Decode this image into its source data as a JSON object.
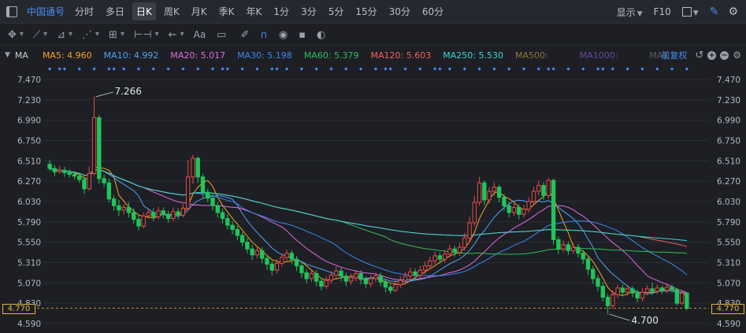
{
  "toolbar": {
    "stock_name": "中国通号",
    "periods": [
      "分时",
      "多日",
      "日K",
      "周K",
      "月K",
      "季K",
      "年K",
      "1分",
      "3分",
      "5分",
      "15分",
      "30分",
      "60分"
    ],
    "active_period": "日K",
    "display_label": "显示",
    "f10_label": "F10"
  },
  "drawing_tools": [
    "crosshair-icon",
    "line-icon",
    "ray-icon",
    "wave-icon",
    "grid-icon",
    "range-icon",
    "arrow-left-icon",
    "text-icon",
    "comment-icon",
    "eraser-icon",
    "magnet-icon",
    "eye-icon",
    "trash-icon",
    "toggle-icon"
  ],
  "ma_bar": {
    "label": "MA",
    "items": [
      {
        "label": "MA5: 4.960",
        "color": "#f5a623"
      },
      {
        "label": "MA10: 4.992",
        "color": "#4fa3f7"
      },
      {
        "label": "MA20: 5.017",
        "color": "#e06ce0"
      },
      {
        "label": "MA30: 5.198",
        "color": "#3f86f0"
      },
      {
        "label": "MA60: 5.379",
        "color": "#2fbf5a"
      },
      {
        "label": "MA120: 5.603",
        "color": "#f06262"
      },
      {
        "label": "MA250: 5.530",
        "color": "#38d6d6"
      },
      {
        "label": "MA500:",
        "color": "#8a7a3a"
      },
      {
        "label": "MA1000:",
        "color": "#6a4a9a"
      },
      {
        "label": "MA1",
        "color": "#5a5f66"
      }
    ],
    "adjust_label": "前复权"
  },
  "price_axis": {
    "ticks": [
      "7.470",
      "7.230",
      "6.990",
      "6.750",
      "6.510",
      "6.270",
      "6.030",
      "5.790",
      "5.550",
      "5.310",
      "5.070",
      "4.830",
      "4.590"
    ],
    "current_price": "4.770"
  },
  "colors": {
    "up": "#e84a4a",
    "down": "#22c45a",
    "accent": "#4a8df0",
    "current": "#e3b53e"
  },
  "chart_data": {
    "type": "candlestick",
    "ylim": [
      4.59,
      7.47
    ],
    "high_label": "7.266",
    "low_label": "4.700",
    "candles": [
      [
        6.47,
        6.42,
        6.52,
        6.39
      ],
      [
        6.42,
        6.38,
        6.46,
        6.33
      ],
      [
        6.38,
        6.4,
        6.45,
        6.36
      ],
      [
        6.4,
        6.37,
        6.44,
        6.32
      ],
      [
        6.37,
        6.35,
        6.41,
        6.31
      ],
      [
        6.35,
        6.33,
        6.39,
        6.29
      ],
      [
        6.33,
        6.29,
        6.37,
        6.25
      ],
      [
        6.29,
        6.18,
        6.34,
        6.12
      ],
      [
        6.18,
        6.36,
        6.44,
        6.16
      ],
      [
        6.36,
        7.02,
        7.266,
        6.34
      ],
      [
        7.02,
        6.3,
        7.05,
        6.24
      ],
      [
        6.3,
        6.25,
        6.35,
        6.2
      ],
      [
        6.25,
        6.06,
        6.3,
        6.02
      ],
      [
        6.06,
        5.98,
        6.1,
        5.92
      ],
      [
        5.98,
        5.93,
        6.05,
        5.86
      ],
      [
        5.93,
        5.96,
        6.0,
        5.88
      ],
      [
        5.96,
        5.9,
        6.02,
        5.84
      ],
      [
        5.9,
        5.82,
        5.95,
        5.77
      ],
      [
        5.82,
        5.74,
        5.87,
        5.69
      ],
      [
        5.74,
        5.86,
        5.9,
        5.71
      ],
      [
        5.86,
        5.9,
        5.94,
        5.83
      ],
      [
        5.9,
        5.85,
        5.95,
        5.8
      ],
      [
        5.85,
        5.92,
        5.97,
        5.82
      ],
      [
        5.92,
        5.88,
        5.96,
        5.83
      ],
      [
        5.88,
        5.83,
        5.92,
        5.78
      ],
      [
        5.83,
        5.91,
        5.96,
        5.8
      ],
      [
        5.91,
        5.87,
        5.95,
        5.82
      ],
      [
        5.87,
        5.95,
        6.0,
        5.84
      ],
      [
        5.95,
        6.32,
        6.52,
        5.92
      ],
      [
        6.32,
        6.54,
        6.58,
        6.24
      ],
      [
        6.54,
        6.32,
        6.56,
        6.25
      ],
      [
        6.32,
        6.14,
        6.36,
        6.08
      ],
      [
        6.14,
        6.07,
        6.18,
        6.02
      ],
      [
        6.07,
        5.98,
        6.12,
        5.92
      ],
      [
        5.98,
        5.9,
        6.02,
        5.84
      ],
      [
        5.9,
        5.83,
        5.95,
        5.77
      ],
      [
        5.83,
        5.75,
        5.88,
        5.7
      ],
      [
        5.75,
        5.7,
        5.8,
        5.64
      ],
      [
        5.7,
        5.63,
        5.74,
        5.57
      ],
      [
        5.63,
        5.55,
        5.67,
        5.5
      ],
      [
        5.55,
        5.47,
        5.6,
        5.42
      ],
      [
        5.47,
        5.4,
        5.52,
        5.34
      ],
      [
        5.4,
        5.45,
        5.5,
        5.36
      ],
      [
        5.45,
        5.36,
        5.49,
        5.3
      ],
      [
        5.36,
        5.29,
        5.4,
        5.22
      ],
      [
        5.29,
        5.22,
        5.33,
        5.16
      ],
      [
        5.22,
        5.3,
        5.35,
        5.18
      ],
      [
        5.3,
        5.37,
        5.42,
        5.26
      ],
      [
        5.37,
        5.42,
        5.46,
        5.33
      ],
      [
        5.42,
        5.35,
        5.46,
        5.29
      ],
      [
        5.35,
        5.27,
        5.39,
        5.21
      ],
      [
        5.27,
        5.19,
        5.31,
        5.13
      ],
      [
        5.19,
        5.12,
        5.23,
        5.06
      ],
      [
        5.12,
        5.18,
        5.23,
        5.08
      ],
      [
        5.18,
        5.09,
        5.22,
        5.03
      ],
      [
        5.09,
        5.03,
        5.13,
        4.98
      ],
      [
        5.03,
        5.1,
        5.15,
        5.0
      ],
      [
        5.1,
        5.16,
        5.21,
        5.06
      ],
      [
        5.16,
        5.21,
        5.26,
        5.12
      ],
      [
        5.21,
        5.15,
        5.25,
        5.09
      ],
      [
        5.15,
        5.09,
        5.19,
        5.03
      ],
      [
        5.09,
        5.13,
        5.18,
        5.05
      ],
      [
        5.13,
        5.18,
        5.22,
        5.09
      ],
      [
        5.18,
        5.11,
        5.22,
        5.05
      ],
      [
        5.11,
        5.06,
        5.15,
        5.01
      ],
      [
        5.06,
        5.12,
        5.16,
        5.02
      ],
      [
        5.12,
        5.15,
        5.19,
        5.08
      ],
      [
        5.15,
        5.08,
        5.19,
        5.03
      ],
      [
        5.08,
        5.02,
        5.12,
        4.96
      ],
      [
        5.02,
        4.98,
        5.06,
        4.94
      ],
      [
        4.98,
        5.05,
        5.1,
        4.96
      ],
      [
        5.05,
        5.1,
        5.15,
        5.01
      ],
      [
        5.1,
        5.15,
        5.2,
        5.06
      ],
      [
        5.15,
        5.2,
        5.25,
        5.11
      ],
      [
        5.2,
        5.16,
        5.24,
        5.11
      ],
      [
        5.16,
        5.22,
        5.27,
        5.12
      ],
      [
        5.22,
        5.27,
        5.32,
        5.18
      ],
      [
        5.27,
        5.33,
        5.38,
        5.23
      ],
      [
        5.33,
        5.39,
        5.44,
        5.29
      ],
      [
        5.39,
        5.35,
        5.43,
        5.3
      ],
      [
        5.35,
        5.41,
        5.46,
        5.31
      ],
      [
        5.41,
        5.47,
        5.52,
        5.37
      ],
      [
        5.47,
        5.43,
        5.51,
        5.38
      ],
      [
        5.43,
        5.49,
        5.54,
        5.39
      ],
      [
        5.49,
        5.6,
        5.66,
        5.45
      ],
      [
        5.6,
        5.78,
        5.85,
        5.56
      ],
      [
        5.78,
        6.02,
        6.1,
        5.74
      ],
      [
        6.02,
        6.25,
        6.32,
        5.98
      ],
      [
        6.25,
        6.05,
        6.28,
        5.99
      ],
      [
        6.05,
        6.15,
        6.2,
        6.0
      ],
      [
        6.15,
        6.2,
        6.26,
        6.1
      ],
      [
        6.2,
        6.08,
        6.23,
        6.02
      ],
      [
        6.08,
        5.98,
        6.12,
        5.92
      ],
      [
        5.98,
        5.9,
        6.03,
        5.84
      ],
      [
        5.9,
        5.96,
        6.01,
        5.86
      ],
      [
        5.96,
        5.88,
        6.0,
        5.82
      ],
      [
        5.88,
        5.94,
        5.99,
        5.84
      ],
      [
        5.94,
        6.03,
        6.08,
        5.9
      ],
      [
        6.03,
        6.15,
        6.2,
        5.98
      ],
      [
        6.15,
        6.22,
        6.28,
        6.1
      ],
      [
        6.22,
        6.1,
        6.26,
        6.05
      ],
      [
        6.1,
        6.28,
        6.31,
        6.06
      ],
      [
        6.28,
        5.58,
        6.3,
        5.52
      ],
      [
        5.58,
        5.47,
        5.62,
        5.41
      ],
      [
        5.47,
        5.52,
        5.57,
        5.43
      ],
      [
        5.52,
        5.45,
        5.56,
        5.4
      ],
      [
        5.45,
        5.49,
        5.54,
        5.41
      ],
      [
        5.49,
        5.42,
        5.53,
        5.37
      ],
      [
        5.42,
        5.35,
        5.46,
        5.29
      ],
      [
        5.35,
        5.23,
        5.39,
        5.16
      ],
      [
        5.23,
        5.12,
        5.27,
        5.06
      ],
      [
        5.12,
        5.03,
        5.16,
        4.97
      ],
      [
        5.03,
        4.9,
        5.08,
        4.85
      ],
      [
        4.9,
        4.8,
        4.94,
        4.7
      ],
      [
        4.8,
        4.93,
        4.98,
        4.77
      ],
      [
        4.93,
        5.01,
        5.05,
        4.89
      ],
      [
        5.01,
        4.96,
        5.05,
        4.91
      ],
      [
        4.96,
        5.0,
        5.04,
        4.92
      ],
      [
        5.0,
        4.95,
        5.03,
        4.9
      ],
      [
        4.95,
        4.89,
        4.99,
        4.84
      ],
      [
        4.89,
        4.96,
        5.01,
        4.85
      ],
      [
        4.96,
        5.0,
        5.04,
        4.92
      ],
      [
        5.0,
        4.97,
        5.07,
        4.93
      ],
      [
        4.97,
        5.01,
        5.05,
        4.94
      ],
      [
        5.01,
        4.98,
        5.04,
        4.94
      ],
      [
        4.98,
        5.02,
        5.06,
        4.95
      ],
      [
        5.02,
        4.99,
        5.05,
        4.95
      ],
      [
        4.99,
        4.83,
        5.01,
        4.8
      ],
      [
        4.83,
        4.95,
        4.99,
        4.81
      ],
      [
        4.95,
        4.77,
        4.96,
        4.75
      ]
    ]
  }
}
